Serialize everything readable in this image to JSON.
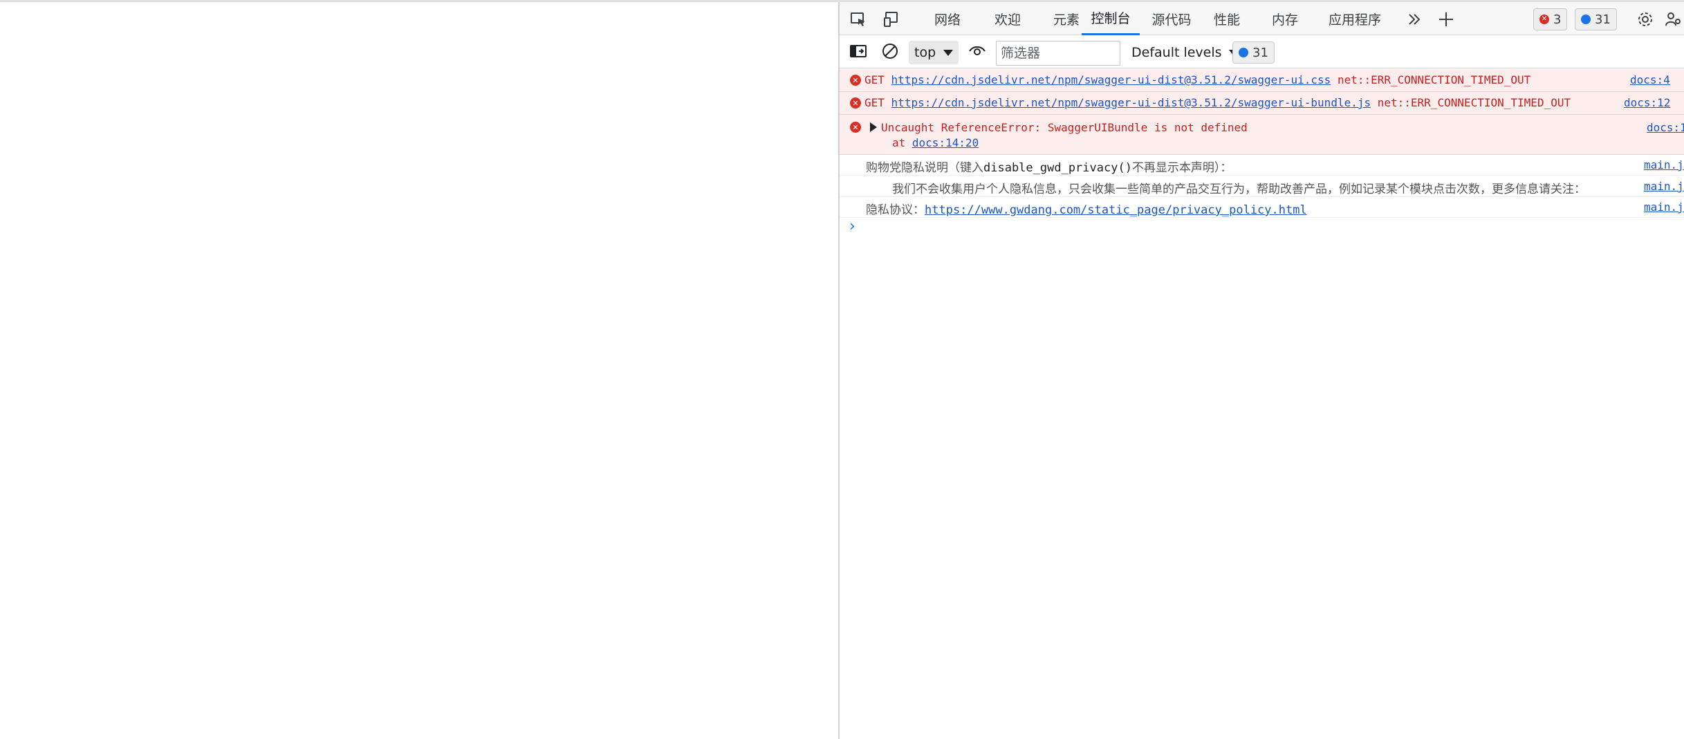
{
  "tabs": [
    {
      "label": "网络"
    },
    {
      "label": "欢迎"
    },
    {
      "label": "元素"
    },
    {
      "label": "控制台"
    },
    {
      "label": "源代码"
    },
    {
      "label": "性能"
    },
    {
      "label": "内存"
    },
    {
      "label": "应用程序"
    }
  ],
  "active_tab": "控制台",
  "status": {
    "errors": "3",
    "messages": "31"
  },
  "toolbar": {
    "context": "top",
    "filter_placeholder": "筛选器",
    "levels": "Default levels",
    "message_count": "31"
  },
  "console": {
    "entries": [
      {
        "method": "GET",
        "url": "https://cdn.jsdelivr.net/npm/swagger-ui-dist@3.51.2/swagger-ui.css",
        "error": "net::ERR_CONNECTION_TIMED_OUT",
        "source": "docs:4"
      },
      {
        "method": "GET",
        "url": "https://cdn.jsdelivr.net/npm/swagger-ui-dist@3.51.2/swagger-ui-bundle.js",
        "error": "net::ERR_CONNECTION_TIMED_OUT",
        "source": "docs:12"
      },
      {
        "message": "Uncaught ReferenceError: SwaggerUIBundle is not defined",
        "stack_prefix": "at ",
        "stack_link": "docs:14:20",
        "source": "docs:1"
      },
      {
        "prefix": "购物党隐私说明（键入",
        "code": "disable_gwd_privacy()",
        "suffix": "不再显示本声明）：",
        "source": "main.j"
      },
      {
        "text": "我们不会收集用户个人隐私信息，只会收集一些简单的产品交互行为，帮助改善产品，例如记录某个模块点击次数，更多信息请关注：",
        "source": "main.j"
      },
      {
        "prefix": "隐私协议：",
        "url": "https://www.gwdang.com/static_page/privacy_policy.html",
        "source": "main.j"
      }
    ]
  }
}
